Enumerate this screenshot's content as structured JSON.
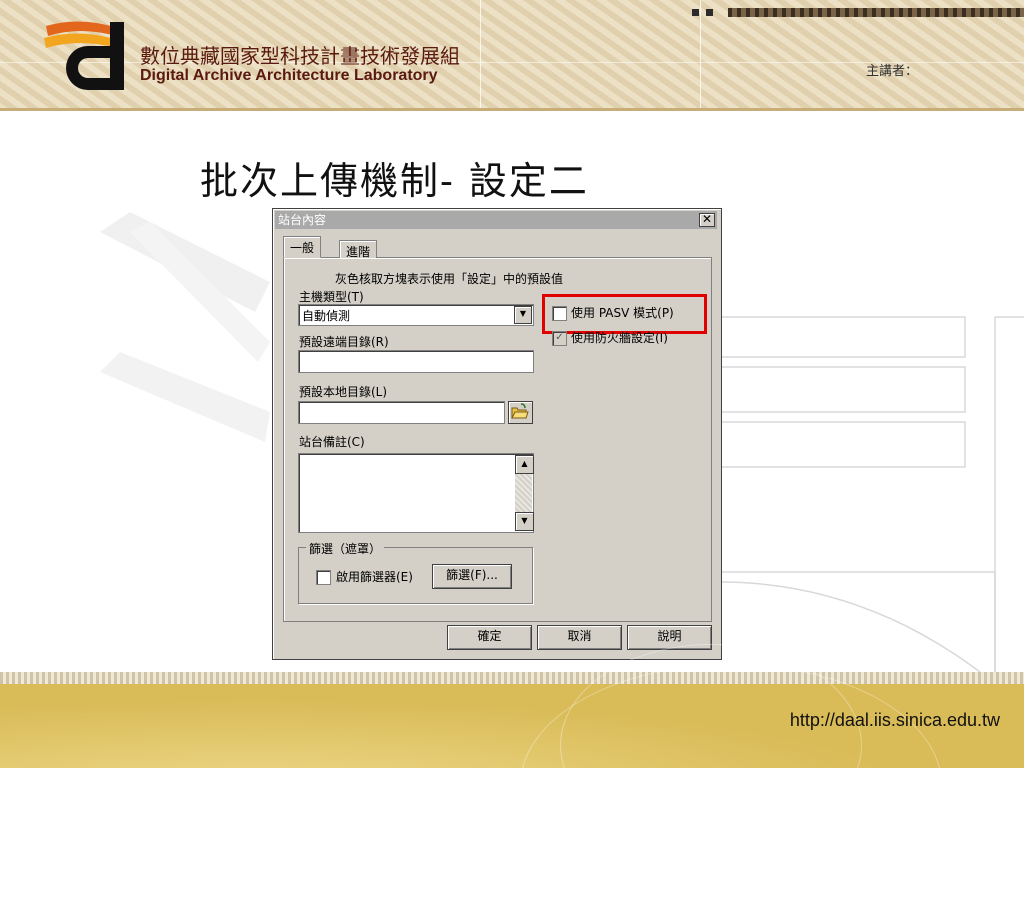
{
  "header": {
    "org_name_cn": "數位典藏國家型科技計畫技術發展組",
    "org_name_en": "Digital Archive Architecture Laboratory",
    "speaker_label": "主講者："
  },
  "slide": {
    "title": "批次上傳機制- 設定二"
  },
  "dialog": {
    "title": "站台內容",
    "close_label": "✕",
    "tabs": [
      {
        "label": "一般",
        "active": true
      },
      {
        "label": "進階",
        "active": false
      }
    ],
    "hint": "灰色核取方塊表示使用「設定」中的預設值",
    "host_type_label": "主機類型(T)",
    "host_type_value": "自動偵測",
    "remote_dir_label": "預設遠端目錄(R)",
    "remote_dir_value": "",
    "local_dir_label": "預設本地目錄(L)",
    "local_dir_value": "",
    "site_note_label": "站台備註(C)",
    "site_note_value": "",
    "pasv_label": "使用 PASV 模式(P)",
    "pasv_checked": false,
    "firewall_label": "使用防火牆設定(I)",
    "firewall_checked": true,
    "filter_group_label": "篩選（遮罩）",
    "enable_filter_label": "啟用篩選器(E)",
    "filter_button_label": "篩選(F)...",
    "ok_label": "確定",
    "cancel_label": "取消",
    "help_label": "說明"
  },
  "footer": {
    "url": "http://daal.iis.sinica.edu.tw"
  },
  "colors": {
    "highlight": "#e00000",
    "banner": "#e8d9b8",
    "footer": "#d9bb57",
    "brand_text": "#5a1a10"
  }
}
